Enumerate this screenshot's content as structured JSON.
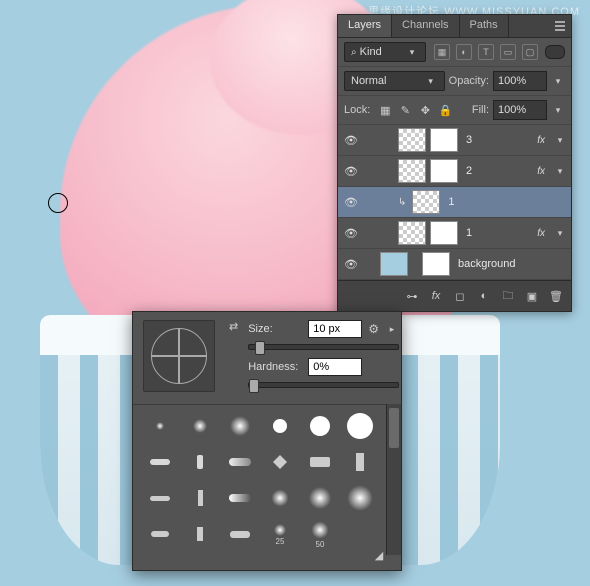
{
  "watermark": "思缘设计论坛 WWW.MISSYUAN.COM",
  "layers_panel": {
    "tabs": {
      "layers": "Layers",
      "channels": "Channels",
      "paths": "Paths"
    },
    "kind_filter": "Kind",
    "blend_mode": "Normal",
    "opacity_label": "Opacity:",
    "opacity_value": "100%",
    "lock_label": "Lock:",
    "fill_label": "Fill:",
    "fill_value": "100%",
    "rows": [
      {
        "name": "3",
        "fx": true,
        "clip": false,
        "selected": false,
        "mask": true,
        "trans": true
      },
      {
        "name": "2",
        "fx": true,
        "clip": false,
        "selected": false,
        "mask": true,
        "trans": true
      },
      {
        "name": "1",
        "fx": false,
        "clip": true,
        "selected": true,
        "mask": false,
        "trans": true
      },
      {
        "name": "1",
        "fx": true,
        "clip": false,
        "selected": false,
        "mask": true,
        "trans": true
      },
      {
        "name": "background",
        "fx": false,
        "clip": false,
        "selected": false,
        "mask": true,
        "trans": false
      }
    ]
  },
  "brush_panel": {
    "size_label": "Size:",
    "size_value": "10 px",
    "hardness_label": "Hardness:",
    "hardness_value": "0%",
    "preset_labels": {
      "p25": "25",
      "p50": "50"
    }
  }
}
